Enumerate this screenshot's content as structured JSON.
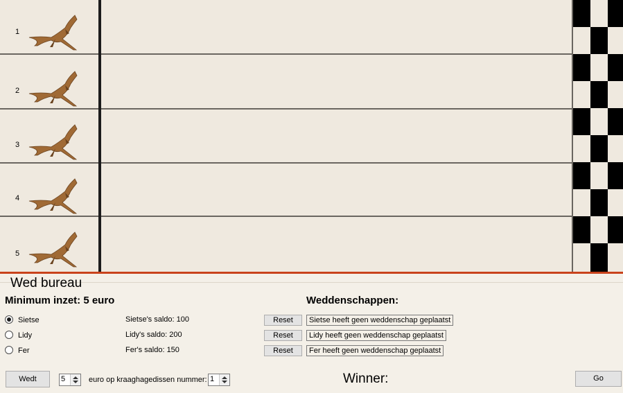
{
  "lanes": [
    {
      "number": "1"
    },
    {
      "number": "2"
    },
    {
      "number": "3"
    },
    {
      "number": "4"
    },
    {
      "number": "5"
    }
  ],
  "panel": {
    "title": "Wed bureau",
    "minimum": "Minimum inzet: 5 euro",
    "bets_header": "Weddenschappen:",
    "bettors": [
      {
        "name": "Sietse",
        "selected": true,
        "balance": "Sietse's saldo: 100",
        "bet": "Sietse heeft geen weddenschap geplaatst"
      },
      {
        "name": "Lidy",
        "selected": false,
        "balance": "Lidy's saldo: 200",
        "bet": "Lidy heeft geen weddenschap geplaatst"
      },
      {
        "name": "Fer",
        "selected": false,
        "balance": "Fer's saldo: 150",
        "bet": "Fer heeft geen weddenschap geplaatst"
      }
    ],
    "reset_label": "Reset",
    "bet_button": "Wedt",
    "amount": "5",
    "amount_text": "euro op kraaghagedissen nummer:",
    "lizard_number": "1",
    "winner_label": "Winner:",
    "go_button": "Go"
  },
  "colors": {
    "accent": "#c9431c",
    "track": "#efe9df",
    "lizard": "#a06a35"
  },
  "icons": [
    "lizard-icon",
    "radio-icon",
    "spinner-arrows-icon"
  ]
}
